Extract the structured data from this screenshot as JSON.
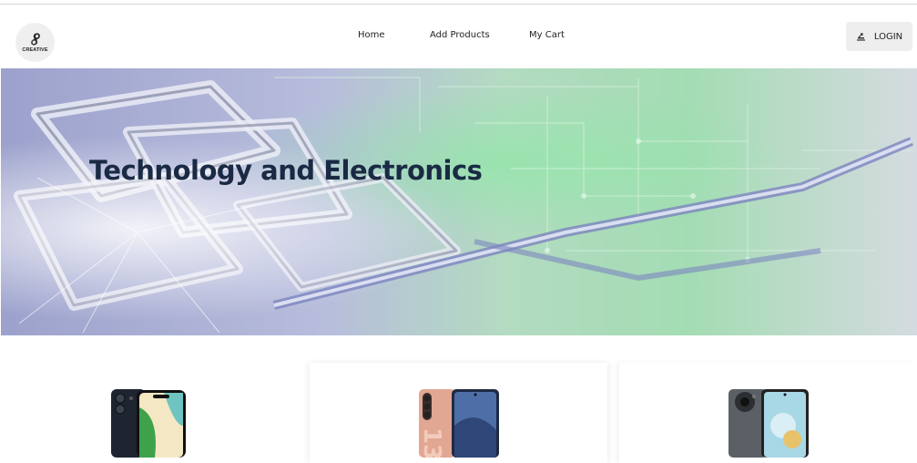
{
  "brand": {
    "logo_icon": "swirl-logo-icon",
    "logo_text": "CREATIVE"
  },
  "nav": {
    "items": [
      {
        "label": "Home"
      },
      {
        "label": "Add Products"
      },
      {
        "label": "My Cart"
      }
    ],
    "login": {
      "label": "LOGIN",
      "icon": "login-arrow-icon"
    }
  },
  "hero": {
    "title": "Technology and Electronics",
    "image": "circuit-chip-graphic"
  },
  "products": [
    {
      "image": "iphone-dark-phone"
    },
    {
      "image": "pink-phone-13"
    },
    {
      "image": "gray-phone-round-camera"
    }
  ],
  "colors": {
    "hero_title": "#1a2a44",
    "login_bg": "#eeeeee",
    "divider": "#d6d6d6"
  }
}
